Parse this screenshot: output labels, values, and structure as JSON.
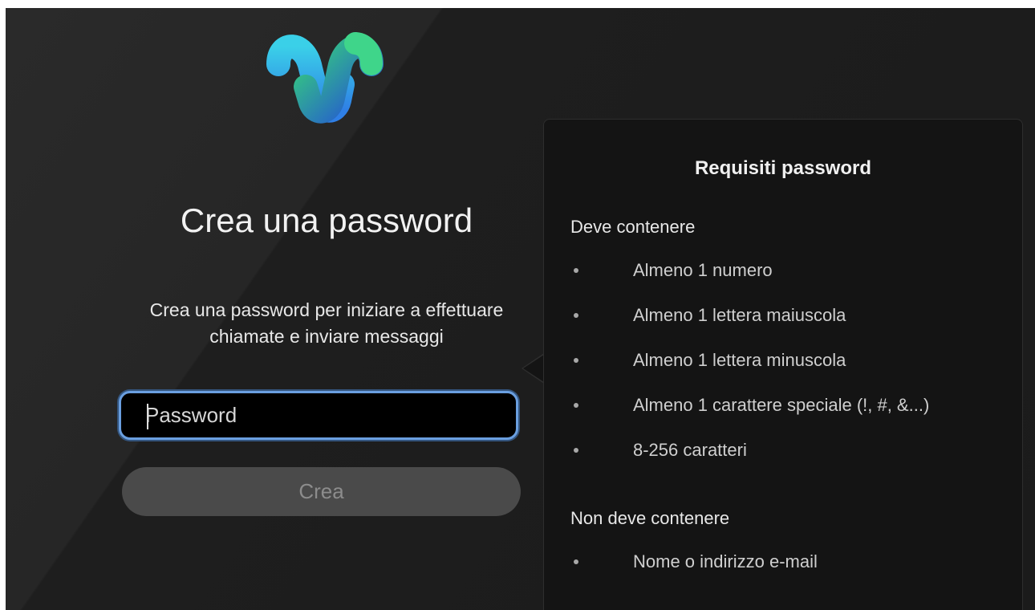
{
  "logo": {
    "icon": "webex-logo-icon",
    "colors": [
      "#2ecf8e",
      "#3cb6f0",
      "#3b5ce6",
      "#1b2fb8"
    ]
  },
  "page": {
    "title": "Crea una password",
    "subtitle_line1": "Crea una password per iniziare a effettuare",
    "subtitle_line2": "chiamate e inviare messaggi"
  },
  "password_field": {
    "placeholder": "Password",
    "value": ""
  },
  "create_button": {
    "label": "Crea",
    "disabled": true
  },
  "requirements": {
    "title": "Requisiti password",
    "must_contain_label": "Deve contenere",
    "must_contain": [
      "Almeno 1 numero",
      "Almeno 1 lettera maiuscola",
      "Almeno 1 lettera minuscola",
      "Almeno 1 carattere speciale (!, #, &...)",
      "8-256 caratteri"
    ],
    "must_not_contain_label": "Non deve contenere",
    "must_not_contain": [
      "Nome o indirizzo e-mail"
    ]
  },
  "colors": {
    "background": "#1b1b1b",
    "input_focus_border": "#6a9fe0",
    "button_disabled_bg": "#4a4a4a",
    "popover_bg": "#141414"
  }
}
